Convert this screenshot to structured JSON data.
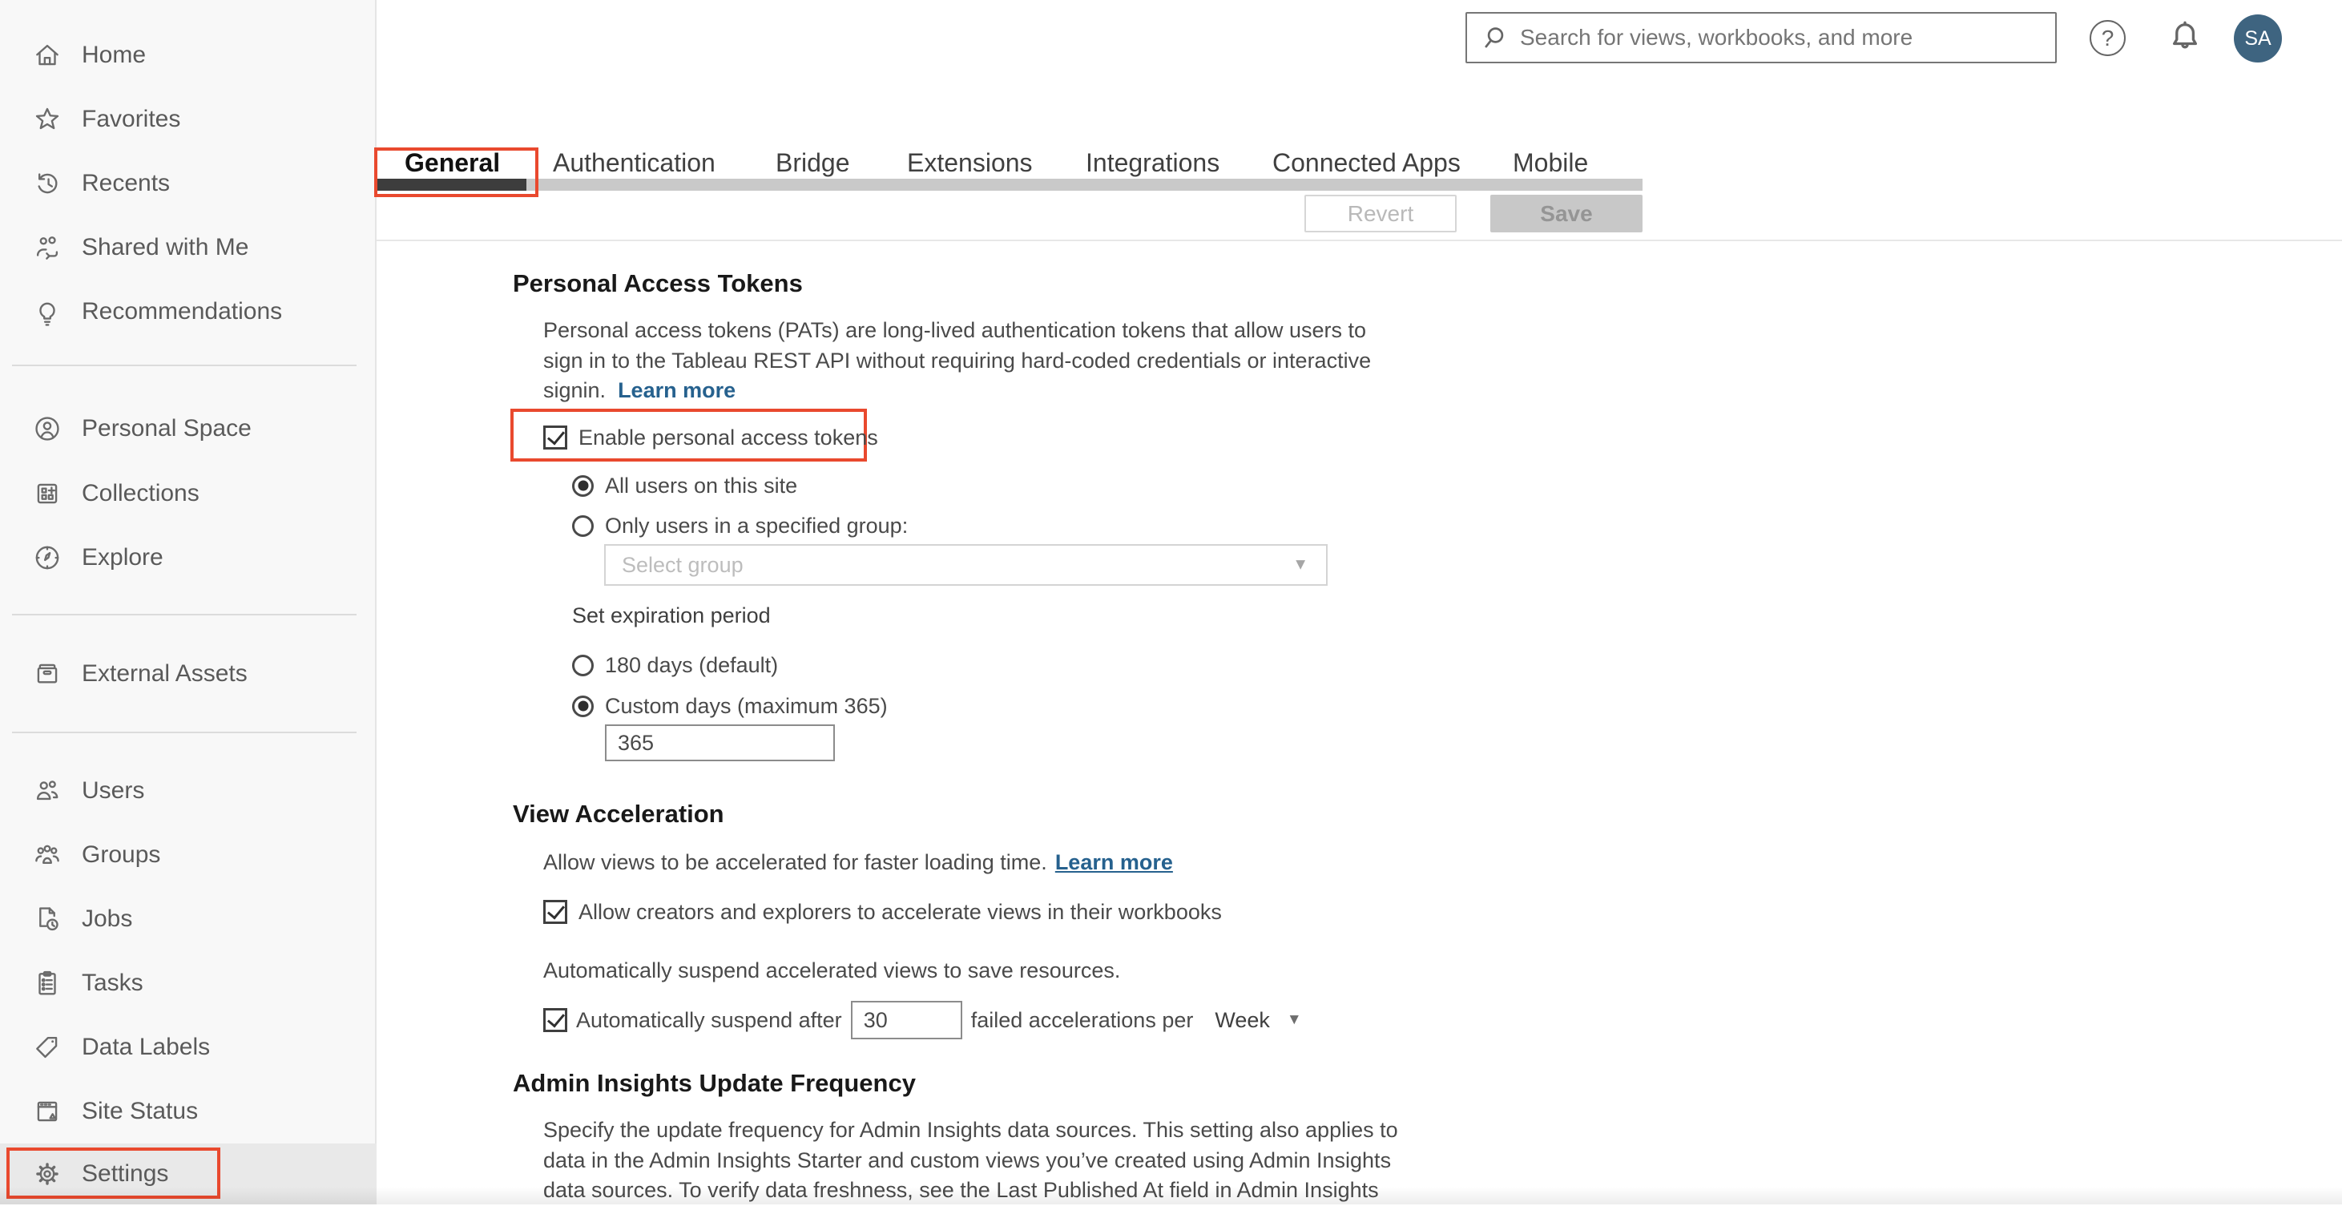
{
  "topbar": {
    "search_placeholder": "Search for views, workbooks, and more",
    "help_glyph": "?",
    "avatar_initials": "SA"
  },
  "sidebar": {
    "items": [
      {
        "label": "Home",
        "icon": "home-icon"
      },
      {
        "label": "Favorites",
        "icon": "star-icon"
      },
      {
        "label": "Recents",
        "icon": "history-icon"
      },
      {
        "label": "Shared with Me",
        "icon": "shared-with-me-icon"
      },
      {
        "label": "Recommendations",
        "icon": "lightbulb-icon"
      },
      {
        "label": "Personal Space",
        "icon": "person-circle-icon"
      },
      {
        "label": "Collections",
        "icon": "collections-icon"
      },
      {
        "label": "Explore",
        "icon": "compass-icon"
      },
      {
        "label": "External Assets",
        "icon": "archive-icon"
      },
      {
        "label": "Users",
        "icon": "users-icon"
      },
      {
        "label": "Groups",
        "icon": "groups-icon"
      },
      {
        "label": "Jobs",
        "icon": "document-clock-icon"
      },
      {
        "label": "Tasks",
        "icon": "clipboard-icon"
      },
      {
        "label": "Data Labels",
        "icon": "tag-icon"
      },
      {
        "label": "Site Status",
        "icon": "site-status-icon"
      },
      {
        "label": "Settings",
        "icon": "gear-icon",
        "selected": true
      }
    ]
  },
  "tabs": [
    {
      "label": "General",
      "active": true
    },
    {
      "label": "Authentication"
    },
    {
      "label": "Bridge"
    },
    {
      "label": "Extensions"
    },
    {
      "label": "Integrations"
    },
    {
      "label": "Connected Apps"
    },
    {
      "label": "Mobile"
    }
  ],
  "actions": {
    "revert": "Revert",
    "save": "Save"
  },
  "glyphs": {
    "caret_down": "▼"
  },
  "colors": {
    "annotation_red": "#e9492e",
    "link_blue": "#26618e",
    "avatar_bg": "#3e6480"
  },
  "pat": {
    "heading": "Personal Access Tokens",
    "desc_line1": "Personal access tokens (PATs) are long-lived authentication tokens that allow users to",
    "desc_line2": "sign in to the Tableau REST API without requiring hard-coded credentials or interactive",
    "desc_line3": "signin.",
    "learn_more": "Learn more",
    "enable_label": "Enable personal access tokens",
    "radio_all_users": "All users on this site",
    "radio_specified_group": "Only users in a specified group:",
    "select_placeholder": "Select group",
    "expiration_label": "Set expiration period",
    "radio_180_days": "180 days (default)",
    "radio_custom_days": "Custom days (maximum 365)",
    "custom_days_value": "365"
  },
  "view_acceleration": {
    "heading": "View Acceleration",
    "desc": "Allow views to be accelerated for faster loading time.",
    "learn_more": "Learn more",
    "allow_label": "Allow creators and explorers to accelerate views in their workbooks",
    "suspend_desc": "Automatically suspend accelerated views to save resources.",
    "suspend_prefix": "Automatically suspend after",
    "suspend_value": "30",
    "suspend_suffix": "failed accelerations per",
    "suspend_period": "Week"
  },
  "admin_insights": {
    "heading": "Admin Insights Update Frequency",
    "desc_line1": "Specify the update frequency for Admin Insights data sources. This setting also applies to",
    "desc_line2": "data in the Admin Insights Starter and custom views you’ve created using Admin Insights",
    "desc_line3": "data sources. To verify data freshness, see the Last Published At field in Admin Insights"
  }
}
